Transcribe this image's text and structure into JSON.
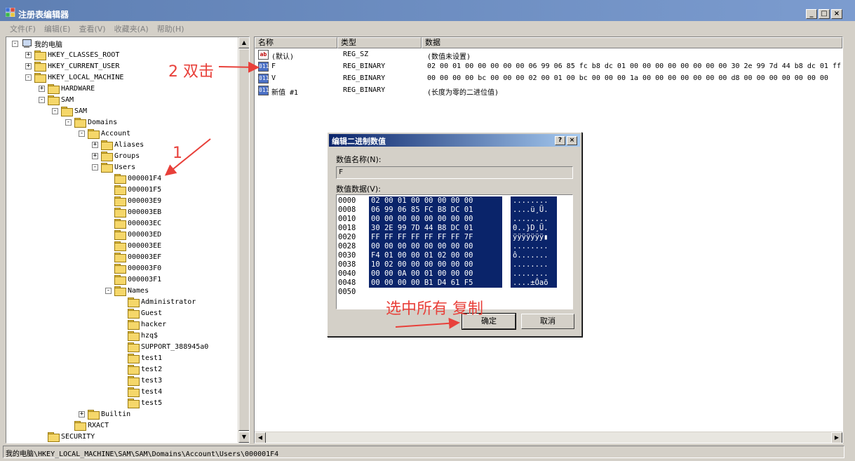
{
  "window": {
    "title": "注册表编辑器",
    "buttons": [
      "_",
      "□",
      "×"
    ]
  },
  "menu": [
    "文件(F)",
    "编辑(E)",
    "查看(V)",
    "收藏夹(A)",
    "帮助(H)"
  ],
  "tree": [
    {
      "label": "我的电脑",
      "level": 0,
      "exp": "-",
      "icon": "pc"
    },
    {
      "label": "HKEY_CLASSES_ROOT",
      "level": 1,
      "exp": "+"
    },
    {
      "label": "HKEY_CURRENT_USER",
      "level": 1,
      "exp": "+"
    },
    {
      "label": "HKEY_LOCAL_MACHINE",
      "level": 1,
      "exp": "-"
    },
    {
      "label": "HARDWARE",
      "level": 2,
      "exp": "+"
    },
    {
      "label": "SAM",
      "level": 2,
      "exp": "-"
    },
    {
      "label": "SAM",
      "level": 3,
      "exp": "-"
    },
    {
      "label": "Domains",
      "level": 4,
      "exp": "-"
    },
    {
      "label": "Account",
      "level": 5,
      "exp": "-"
    },
    {
      "label": "Aliases",
      "level": 6,
      "exp": "+"
    },
    {
      "label": "Groups",
      "level": 6,
      "exp": "+"
    },
    {
      "label": "Users",
      "level": 6,
      "exp": "-"
    },
    {
      "label": "000001F4",
      "level": 7,
      "exp": ""
    },
    {
      "label": "000001F5",
      "level": 7,
      "exp": ""
    },
    {
      "label": "000003E9",
      "level": 7,
      "exp": ""
    },
    {
      "label": "000003EB",
      "level": 7,
      "exp": ""
    },
    {
      "label": "000003EC",
      "level": 7,
      "exp": ""
    },
    {
      "label": "000003ED",
      "level": 7,
      "exp": ""
    },
    {
      "label": "000003EE",
      "level": 7,
      "exp": ""
    },
    {
      "label": "000003EF",
      "level": 7,
      "exp": ""
    },
    {
      "label": "000003F0",
      "level": 7,
      "exp": ""
    },
    {
      "label": "000003F1",
      "level": 7,
      "exp": ""
    },
    {
      "label": "Names",
      "level": 7,
      "exp": "-"
    },
    {
      "label": "Administrator",
      "level": 8,
      "exp": ""
    },
    {
      "label": "Guest",
      "level": 8,
      "exp": ""
    },
    {
      "label": "hacker",
      "level": 8,
      "exp": ""
    },
    {
      "label": "hzq$",
      "level": 8,
      "exp": ""
    },
    {
      "label": "SUPPORT_388945a0",
      "level": 8,
      "exp": ""
    },
    {
      "label": "test1",
      "level": 8,
      "exp": ""
    },
    {
      "label": "test2",
      "level": 8,
      "exp": ""
    },
    {
      "label": "test3",
      "level": 8,
      "exp": ""
    },
    {
      "label": "test4",
      "level": 8,
      "exp": ""
    },
    {
      "label": "test5",
      "level": 8,
      "exp": ""
    },
    {
      "label": "Builtin",
      "level": 5,
      "exp": "+"
    },
    {
      "label": "RXACT",
      "level": 4,
      "exp": ""
    },
    {
      "label": "SECURITY",
      "level": 2,
      "exp": ""
    }
  ],
  "columns": {
    "name": "名称",
    "type": "类型",
    "data": "数据"
  },
  "values": [
    {
      "icon": "ab",
      "name": "(默认)",
      "type": "REG_SZ",
      "data": "(数值未设置)"
    },
    {
      "icon": "bin",
      "name": "F",
      "type": "REG_BINARY",
      "data": "02 00 01 00 00 00 00 00 06 99 06 85 fc b8 dc 01 00 00 00 00 00 00 00 00 30 2e 99 7d 44 b8 dc 01 ff"
    },
    {
      "icon": "bin",
      "name": "V",
      "type": "REG_BINARY",
      "data": "00 00 00 00 bc 00 00 00 02 00 01 00 bc 00 00 00 1a 00 00 00 00 00 00 00 d8 00 00 00 00 00 00 00"
    },
    {
      "icon": "bin",
      "name": "新值 #1",
      "type": "REG_BINARY",
      "data": "(长度为零的二进位值)"
    }
  ],
  "status": "我的电脑\\HKEY_LOCAL_MACHINE\\SAM\\SAM\\Domains\\Account\\Users\\000001F4",
  "dialog": {
    "title": "编辑二进制数值",
    "title_buttons": [
      "?",
      "×"
    ],
    "name_label": "数值名称(N):",
    "name_value": "F",
    "data_label": "数值数据(V):",
    "ok": "确定",
    "cancel": "取消",
    "hex_rows": [
      {
        "off": "0000",
        "bytes": "02 00 01 00 00 00 00 00",
        "ascii": "........"
      },
      {
        "off": "0008",
        "bytes": "06 99 06 85 FC B8 DC 01",
        "ascii": "....ü¸Ü."
      },
      {
        "off": "0010",
        "bytes": "00 00 00 00 00 00 00 00",
        "ascii": "........"
      },
      {
        "off": "0018",
        "bytes": "30 2E 99 7D 44 B8 DC 01",
        "ascii": "0..}D¸Ü."
      },
      {
        "off": "0020",
        "bytes": "FF FF FF FF FF FF FF 7F",
        "ascii": "ÿÿÿÿÿÿÿ▮"
      },
      {
        "off": "0028",
        "bytes": "00 00 00 00 00 00 00 00",
        "ascii": "........"
      },
      {
        "off": "0030",
        "bytes": "F4 01 00 00 01 02 00 00",
        "ascii": "ô......."
      },
      {
        "off": "0038",
        "bytes": "10 02 00 00 00 00 00 00",
        "ascii": "........"
      },
      {
        "off": "0040",
        "bytes": "00 00 0A 00 01 00 00 00",
        "ascii": "........"
      },
      {
        "off": "0048",
        "bytes": "00 00 00 00 B1 D4 61 F5",
        "ascii": "....±Ôaõ"
      },
      {
        "off": "0050",
        "bytes": "",
        "ascii": ""
      }
    ]
  },
  "annotations": {
    "step1": "1",
    "step2": "2 双击",
    "step3": "选中所有 复制"
  },
  "colors": {
    "annotation": "#e8403a",
    "selection": "#0a246a",
    "titlebar": "#5e7fb3"
  }
}
